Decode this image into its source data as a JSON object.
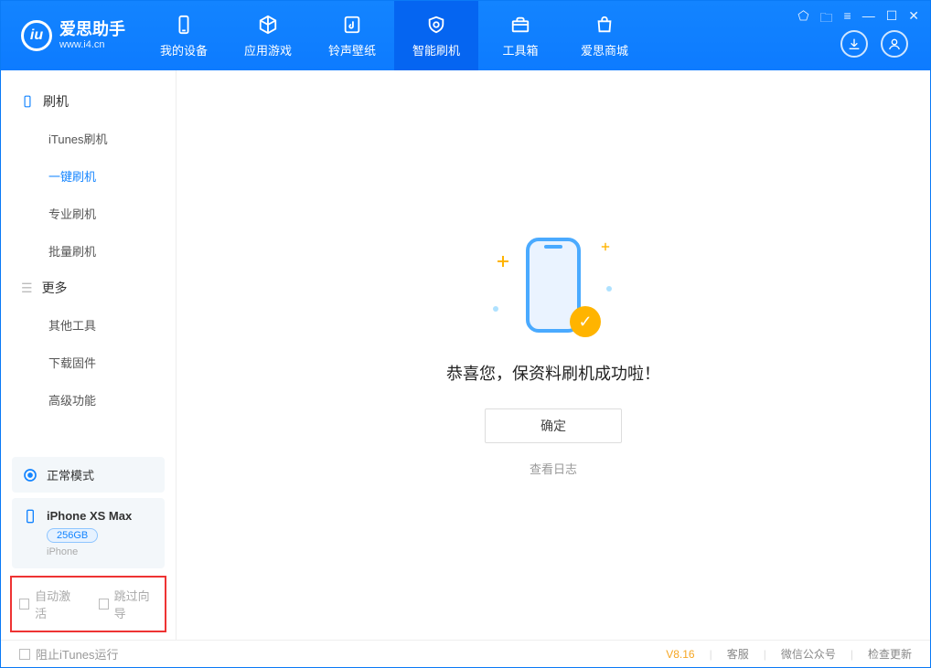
{
  "app": {
    "name": "爱思助手",
    "url": "www.i4.cn"
  },
  "tabs": [
    {
      "label": "我的设备"
    },
    {
      "label": "应用游戏"
    },
    {
      "label": "铃声壁纸"
    },
    {
      "label": "智能刷机"
    },
    {
      "label": "工具箱"
    },
    {
      "label": "爱思商城"
    }
  ],
  "sidebar": {
    "section1": "刷机",
    "items1": [
      "iTunes刷机",
      "一键刷机",
      "专业刷机",
      "批量刷机"
    ],
    "section2": "更多",
    "items2": [
      "其他工具",
      "下载固件",
      "高级功能"
    ]
  },
  "mode_card": "正常模式",
  "device": {
    "name": "iPhone XS Max",
    "storage": "256GB",
    "type": "iPhone"
  },
  "checkboxes": {
    "auto_activate": "自动激活",
    "skip_guide": "跳过向导"
  },
  "main": {
    "success_text": "恭喜您，保资料刷机成功啦！",
    "ok_btn": "确定",
    "view_log": "查看日志"
  },
  "footer": {
    "block_itunes": "阻止iTunes运行",
    "version": "V8.16",
    "links": [
      "客服",
      "微信公众号",
      "检查更新"
    ]
  }
}
